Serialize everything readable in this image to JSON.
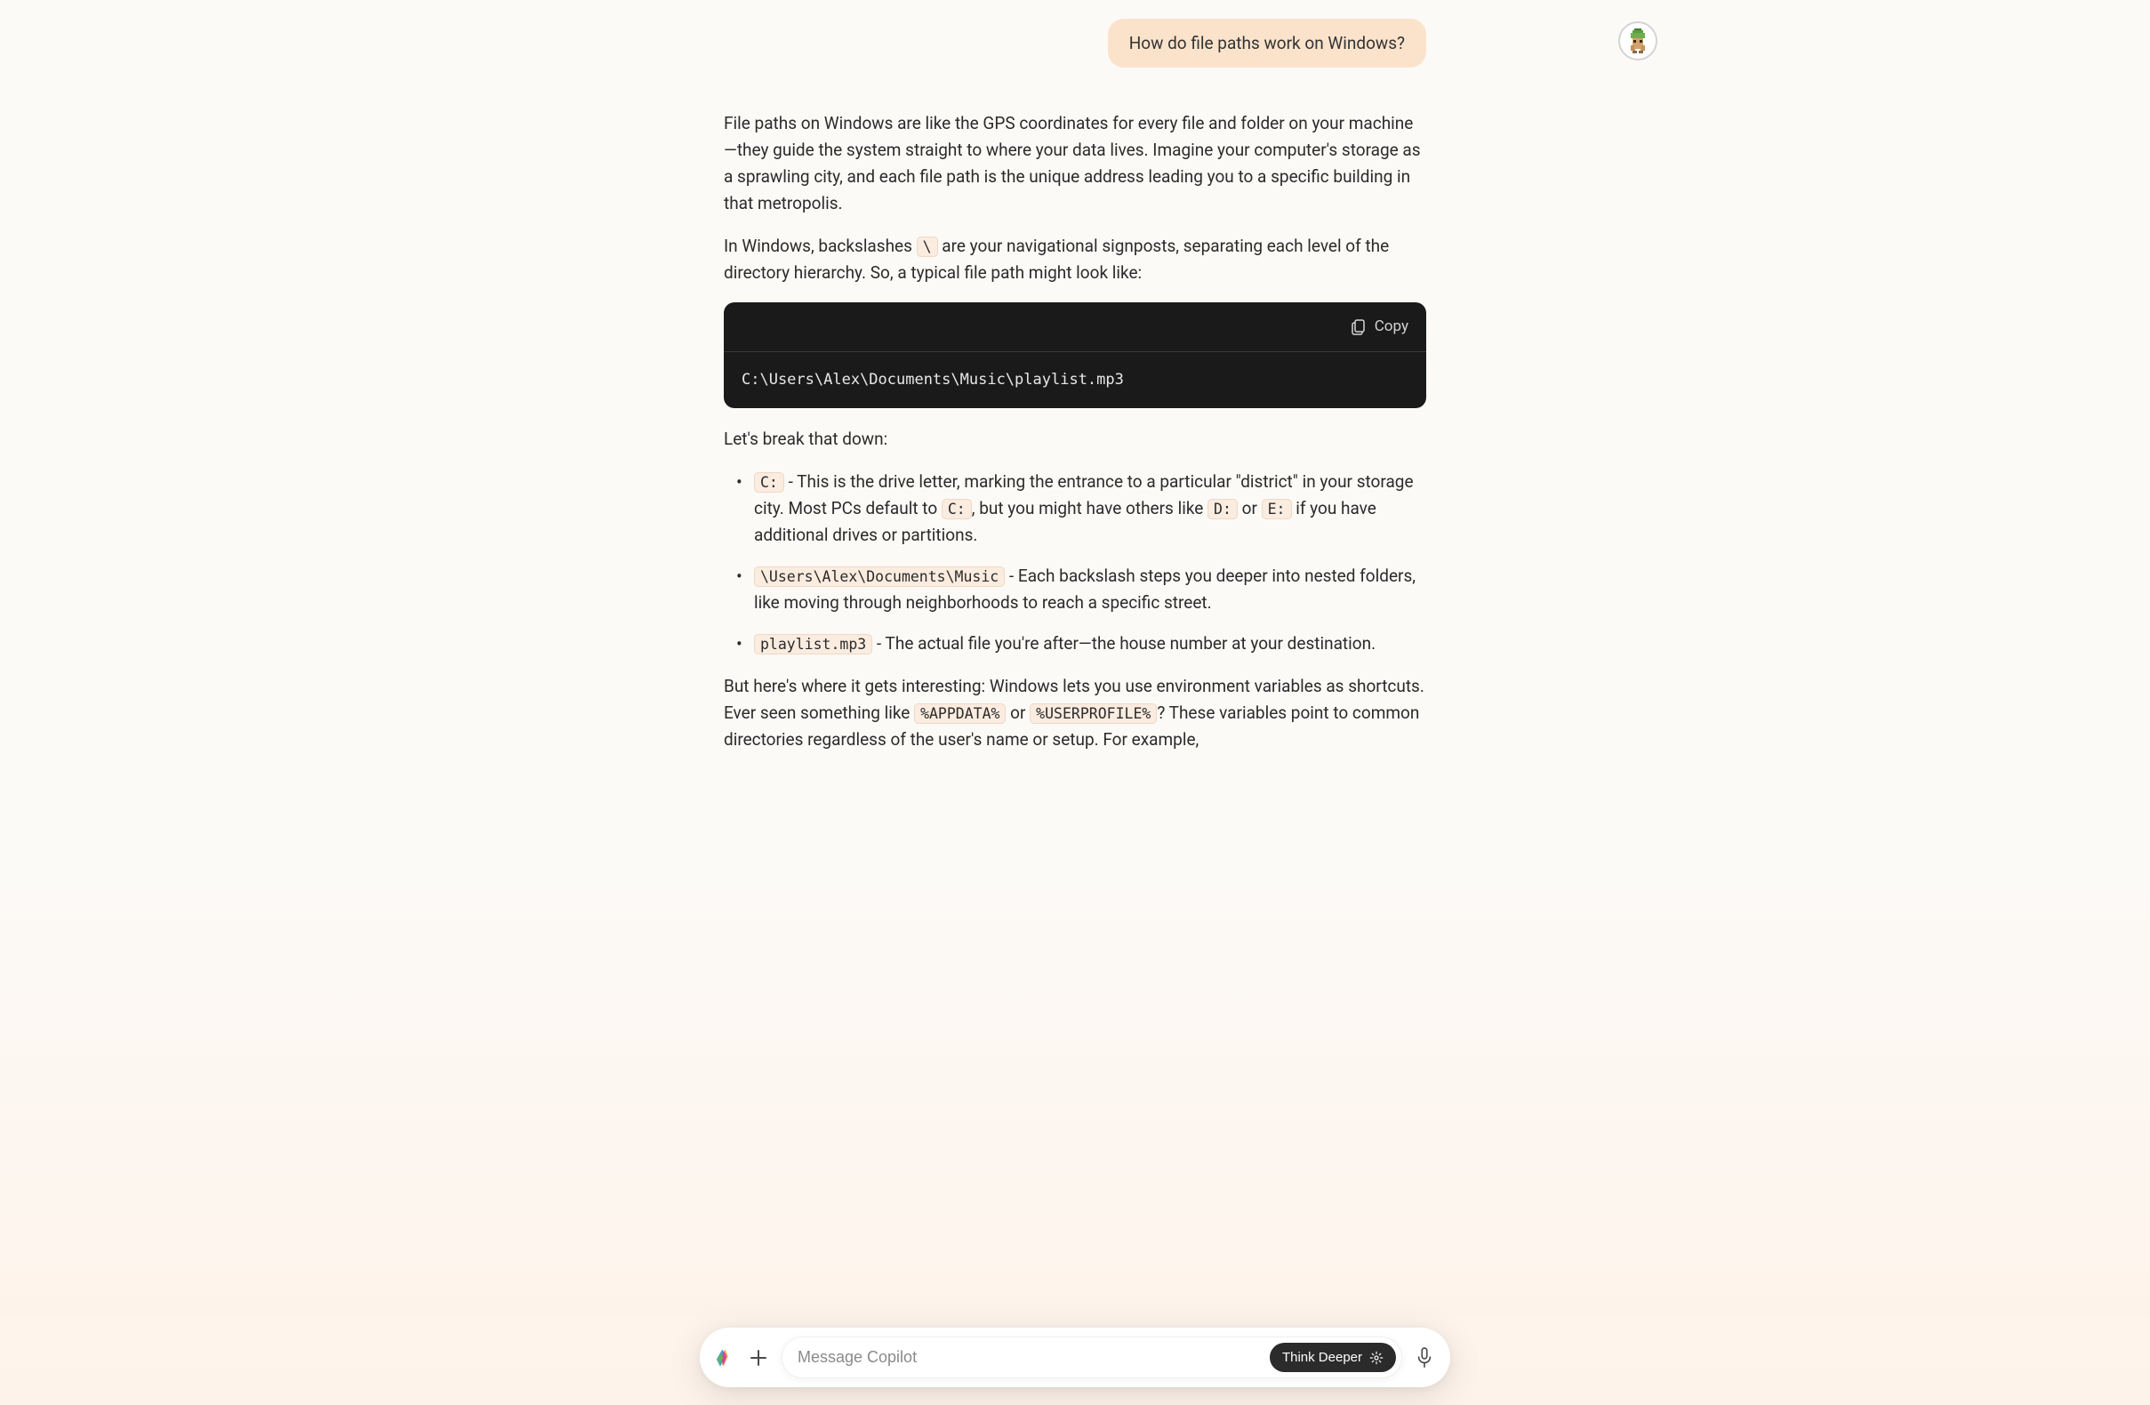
{
  "user_message": "How do file paths work on Windows?",
  "assistant": {
    "p1": "File paths on Windows are like the GPS coordinates for every file and folder on your machine—they guide the system straight to where your data lives. Imagine your computer's storage as a sprawling city, and each file path is the unique address leading you to a specific building in that metropolis.",
    "p2_a": "In Windows, backslashes ",
    "p2_code": "\\",
    "p2_b": " are your navigational signposts, separating each level of the directory hierarchy. So, a typical file path might look like:",
    "code_block": "C:\\Users\\Alex\\Documents\\Music\\playlist.mp3",
    "copy_label": "Copy",
    "p3": "Let's break that down:",
    "li1_code": "C:",
    "li1_a": " - This is the drive letter, marking the entrance to a particular \"district\" in your storage city. Most PCs default to ",
    "li1_code2": "C:",
    "li1_b": ", but you might have others like ",
    "li1_code3": "D:",
    "li1_c": " or ",
    "li1_code4": "E:",
    "li1_d": " if you have additional drives or partitions.",
    "li2_code": "\\Users\\Alex\\Documents\\Music",
    "li2_a": " - Each backslash steps you deeper into nested folders, like moving through neighborhoods to reach a specific street.",
    "li3_code": "playlist.mp3",
    "li3_a": " - The actual file you're after—the house number at your destination.",
    "p4_a": "But here's where it gets interesting: Windows lets you use environment variables as shortcuts. Ever seen something like ",
    "p4_code1": "%APPDATA%",
    "p4_b": " or ",
    "p4_code2": "%USERPROFILE%",
    "p4_c": "? These variables point to common directories regardless of the user's name or setup. For example,"
  },
  "input": {
    "placeholder": "Message Copilot",
    "think_deeper": "Think Deeper"
  }
}
